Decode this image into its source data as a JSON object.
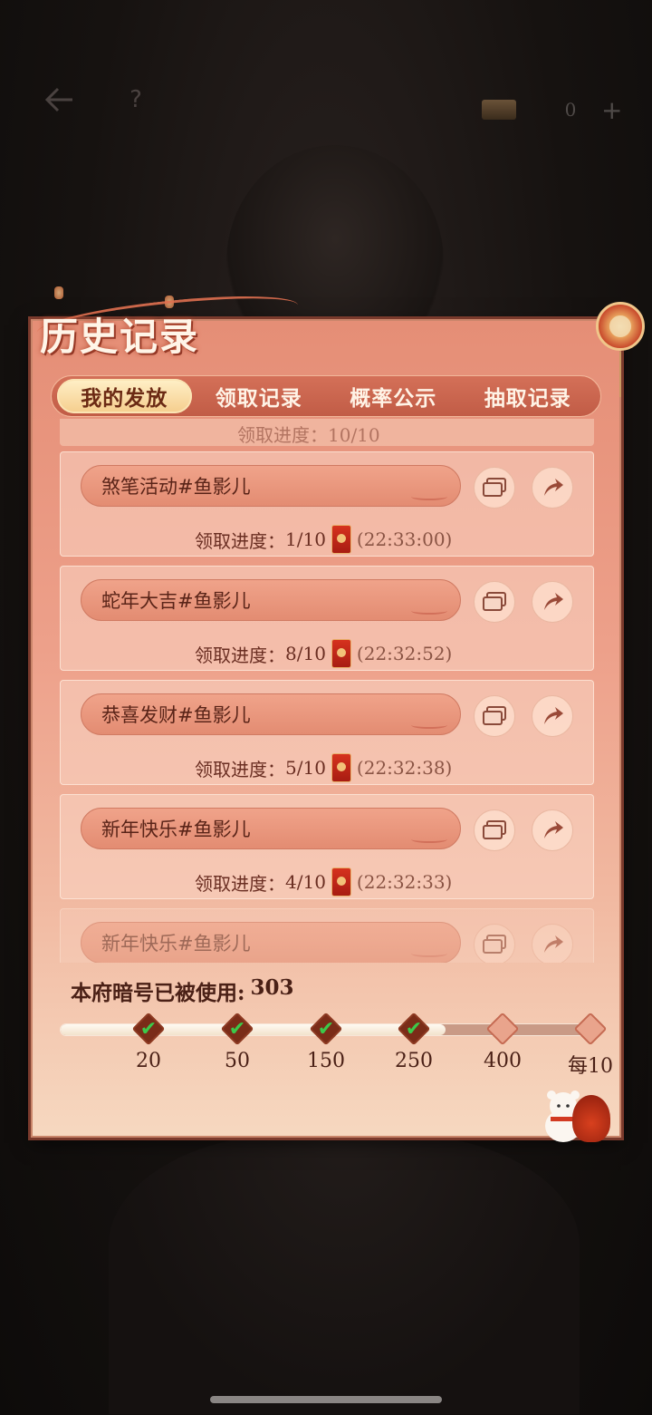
{
  "topbar": {
    "back_icon": "back-arrow-icon",
    "help_label": "?",
    "currency_value": "0",
    "plus_label": "+"
  },
  "panel": {
    "title": "历史记录"
  },
  "tabs": [
    {
      "label": "我的发放",
      "active": true
    },
    {
      "label": "领取记录",
      "active": false
    },
    {
      "label": "概率公示",
      "active": false
    },
    {
      "label": "抽取记录",
      "active": false
    }
  ],
  "partial_row": {
    "text": "领取进度：10/10"
  },
  "records": [
    {
      "name": "煞笔活动#鱼影儿",
      "progress_label": "领取进度：",
      "progress": "1/10",
      "time": "(22:33:00)"
    },
    {
      "name": "蛇年大吉#鱼影儿",
      "progress_label": "领取进度：",
      "progress": "8/10",
      "time": "(22:32:52)"
    },
    {
      "name": "恭喜发财#鱼影儿",
      "progress_label": "领取进度：",
      "progress": "5/10",
      "time": "(22:32:38)"
    },
    {
      "name": "新年快乐#鱼影儿",
      "progress_label": "领取进度：",
      "progress": "4/10",
      "time": "(22:32:33)"
    },
    {
      "name": "新年快乐#鱼影儿",
      "progress_label": "",
      "progress": "",
      "time": ""
    }
  ],
  "usage": {
    "label": "本府暗号已被使用:",
    "value": "303",
    "progress_fraction": 0.72
  },
  "milestones": [
    {
      "label": "20",
      "claimed": true
    },
    {
      "label": "50",
      "claimed": true
    },
    {
      "label": "150",
      "claimed": true
    },
    {
      "label": "250",
      "claimed": true
    },
    {
      "label": "400",
      "claimed": false
    },
    {
      "label": "每10",
      "claimed": false
    }
  ],
  "colors": {
    "accent": "#c15c46",
    "active_tab": "#f5cd8c",
    "check": "#3cc94a"
  }
}
